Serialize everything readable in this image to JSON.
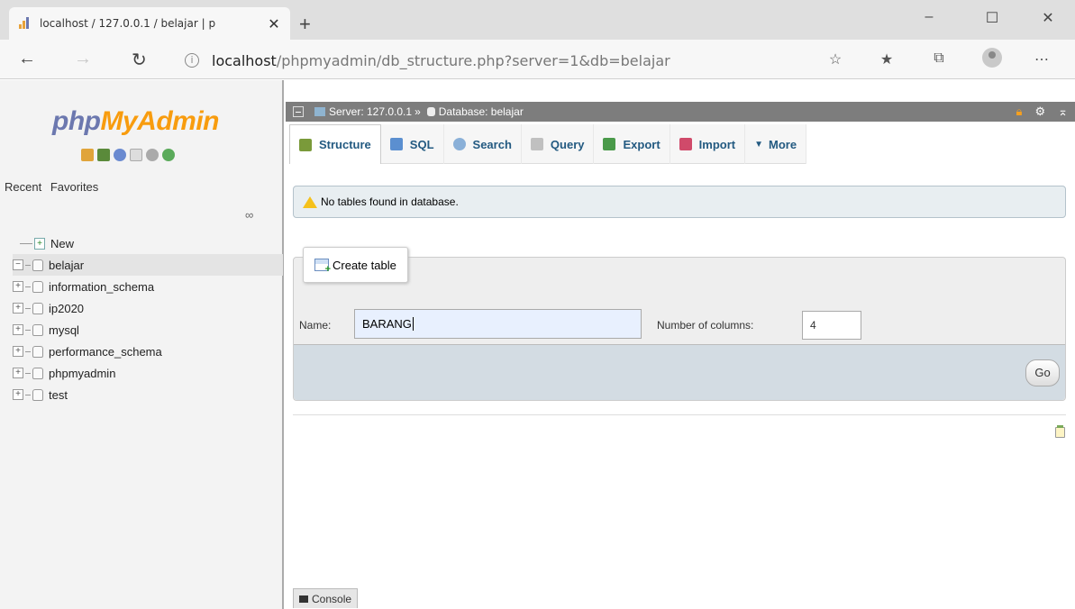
{
  "browser": {
    "tab_title": "localhost / 127.0.0.1 / belajar | p",
    "new_tab": "+",
    "url_host": "localhost",
    "url_path": "/phpmyadmin/db_structure.php?server=1&db=belajar",
    "window_controls": [
      "–",
      "☐",
      "✕"
    ]
  },
  "sidebar": {
    "logo_php": "php",
    "logo_myadmin": "MyAdmin",
    "recent": "Recent",
    "favorites": "Favorites",
    "tree": [
      {
        "label": "New",
        "type": "new"
      },
      {
        "label": "belajar",
        "type": "db",
        "selected": true
      },
      {
        "label": "information_schema",
        "type": "db"
      },
      {
        "label": "ip2020",
        "type": "db"
      },
      {
        "label": "mysql",
        "type": "db"
      },
      {
        "label": "performance_schema",
        "type": "db"
      },
      {
        "label": "phpmyadmin",
        "type": "db"
      },
      {
        "label": "test",
        "type": "db"
      }
    ]
  },
  "breadcrumb": {
    "server": "Server: 127.0.0.1",
    "separator": "»",
    "database": "Database: belajar"
  },
  "tabs": [
    {
      "label": "Structure",
      "icon": "structure-icon",
      "color": "#7a9a3a"
    },
    {
      "label": "SQL",
      "icon": "sql-icon",
      "color": "#5b8fd0"
    },
    {
      "label": "Search",
      "icon": "search-icon",
      "color": "#8ab0d8"
    },
    {
      "label": "Query",
      "icon": "query-icon",
      "color": "#c0c0c0"
    },
    {
      "label": "Export",
      "icon": "export-icon",
      "color": "#4a9a4a"
    },
    {
      "label": "Import",
      "icon": "import-icon",
      "color": "#d04a6a"
    },
    {
      "label": "More",
      "icon": "caret-down-icon",
      "color": "#235a81"
    }
  ],
  "notice": {
    "text": "No tables found in database."
  },
  "create_table": {
    "legend": "Create table",
    "name_label": "Name:",
    "name_value": "BARANG",
    "columns_label": "Number of columns:",
    "columns_value": "4",
    "go_label": "Go"
  },
  "console": {
    "label": "Console"
  },
  "colors": {
    "accent": "#235a81",
    "logo_blue": "#6c78af",
    "logo_orange": "#f89c0e",
    "notice_bg": "#e8eef1",
    "server_bar": "#7d7d7d"
  }
}
